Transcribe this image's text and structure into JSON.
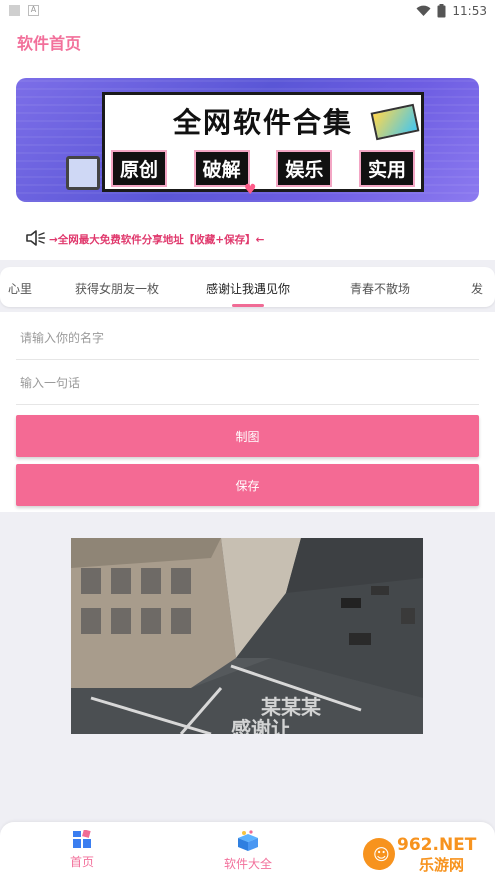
{
  "status_bar": {
    "time": "11:53"
  },
  "header": {
    "title": "软件首页"
  },
  "banner": {
    "title": "全网软件合集",
    "chips": [
      "原创",
      "破解",
      "娱乐",
      "实用"
    ]
  },
  "notice": {
    "text": "→全网最大免费软件分享地址【收藏+保存】←"
  },
  "tabs": [
    {
      "label": "心里"
    },
    {
      "label": "获得女朋友一枚"
    },
    {
      "label": "感谢让我遇见你"
    },
    {
      "label": "青春不散场"
    },
    {
      "label": "发"
    }
  ],
  "form": {
    "name_placeholder": "请输入你的名字",
    "sentence_placeholder": "输入一句话",
    "make_label": "制图",
    "save_label": "保存"
  },
  "photo": {
    "overlay_line1": "某某某",
    "overlay_line2": "感谢让"
  },
  "bottom_nav": [
    {
      "label": "首页"
    },
    {
      "label": "软件大全"
    }
  ],
  "watermark": {
    "brand": "962.NET",
    "site": "乐游网"
  },
  "colors": {
    "accent": "#f46a94",
    "title_pink": "#f2709b",
    "notice_red": "#e0396d"
  },
  "icons": [
    "wifi-icon",
    "battery-icon",
    "speaker-icon",
    "home-icon",
    "gift-box-icon"
  ]
}
